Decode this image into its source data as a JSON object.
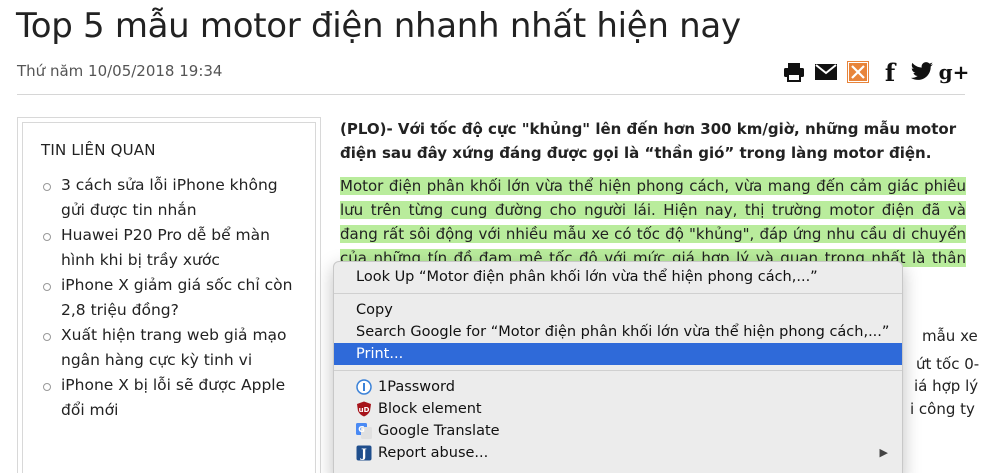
{
  "article": {
    "title": "Top 5 mẫu motor điện nhanh nhất hiện nay",
    "date": "Thứ năm 10/05/2018 19:34",
    "lead": "(PLO)- Với tốc độ cực \"khủng\" lên đến hơn 300 km/giờ, những mẫu motor điện sau đây xứng đáng được gọi là “thần gió” trong làng motor điện.",
    "body_highlighted": "Motor điện phân khối lớn vừa thể hiện phong cách, vừa mang đến cảm giác phiêu lưu trên từng cung đường cho người lái. Hiện nay, thị trường motor điện đã và đang rất sôi động với nhiều mẫu xe có tốc độ \"khủng\", đáp ứng nhu cầu di chuyển của những tín đồ đam mê tốc độ với mức giá hợp lý và quan trọng nhất là thân thiện với môi",
    "body_fragments": [
      "mẫu xe",
      "ứt tốc 0-",
      "iá hợp lý",
      "i công ty"
    ]
  },
  "share": {
    "icons": [
      "print-icon",
      "email-icon",
      "bookmark-icon",
      "facebook-icon",
      "twitter-icon",
      "google-plus-icon"
    ],
    "facebook_glyph": "f",
    "gplus_glyph": "g+"
  },
  "related": {
    "title": "TIN LIÊN QUAN",
    "items": [
      "3 cách sửa lỗi iPhone không gửi được tin nhắn",
      "Huawei P20 Pro dễ bể màn hình khi bị trầy xước",
      "iPhone X giảm giá sốc chỉ còn 2,8 triệu đồng?",
      "Xuất hiện trang web giả mạo ngân hàng cực kỳ tinh vi",
      "iPhone X bị lỗi sẽ được Apple đổi mới"
    ]
  },
  "context_menu": {
    "look_up": "Look Up “Motor điện phân khối lớn vừa thể hiện phong cách,...”",
    "copy": "Copy",
    "search_google": "Search Google for “Motor điện phân khối lớn vừa thể hiện phong cách,...”",
    "print": "Print...",
    "onepassword": "1Password",
    "block_element": "Block element",
    "google_translate": "Google Translate",
    "report_abuse": "Report abuse...",
    "submenu_arrow": "▶"
  },
  "colors": {
    "highlight": "#b9ec9c",
    "menu_selected": "#2f6ad9",
    "menu_bg": "#ececec"
  }
}
